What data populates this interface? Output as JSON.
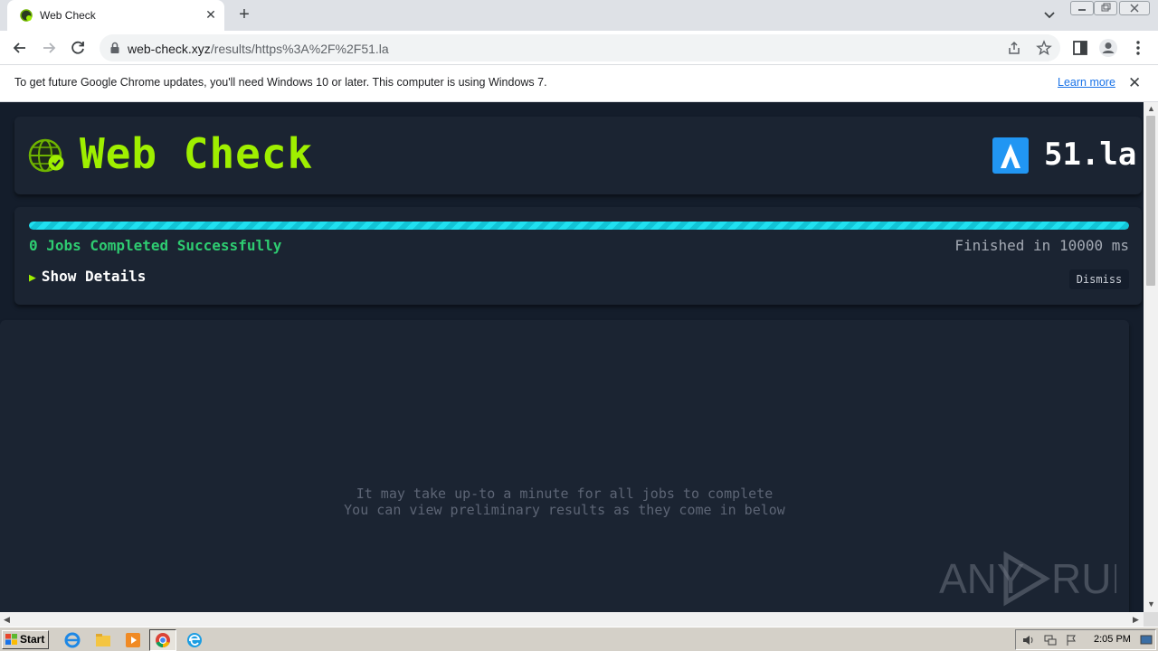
{
  "browser": {
    "tab_title": "Web Check",
    "url_host": "web-check.xyz",
    "url_path": "/results/https%3A%2F%2F51.la"
  },
  "infobar": {
    "message": "To get future Google Chrome updates, you'll need Windows 10 or later. This computer is using Windows 7.",
    "link_label": "Learn more"
  },
  "header": {
    "app_title": "Web Check",
    "site_name": "51.la"
  },
  "progress": {
    "jobs_status": "0 Jobs Completed Successfully",
    "finished": "Finished in 10000 ms",
    "show_details": "Show Details",
    "dismiss": "Dismiss",
    "percent": 100
  },
  "results": {
    "loading_line1": "It may take up-to a minute for all jobs to complete",
    "loading_line2": "You can view preliminary results as they come in below"
  },
  "watermark": {
    "text_left": "ANY",
    "text_right": "RUN"
  },
  "taskbar": {
    "start_label": "Start",
    "clock": "2:05 PM"
  },
  "colors": {
    "accent": "#9fef00",
    "success": "#2ecc71",
    "progress": "#20e0f0",
    "page_bg": "#141d2b",
    "card_bg": "#1b2432"
  }
}
